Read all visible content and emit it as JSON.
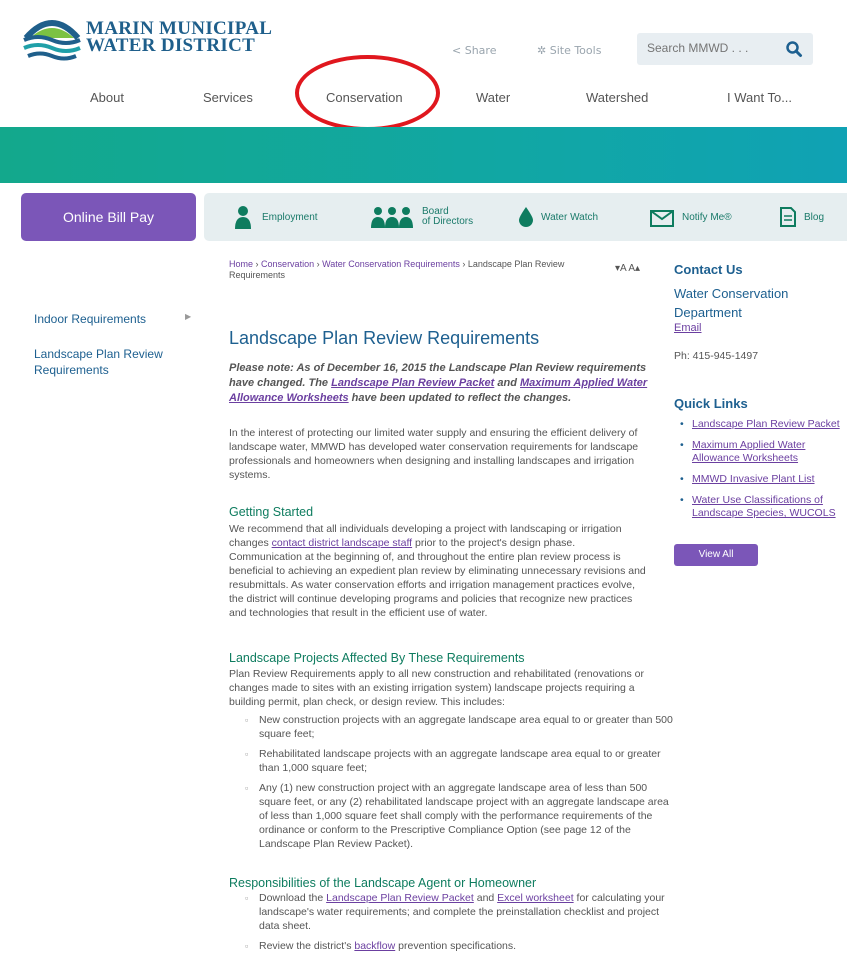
{
  "header": {
    "logo_line1": "MARIN MUNICIPAL",
    "logo_line2": "WATER DISTRICT",
    "share_label": "Share",
    "site_tools_label": "Site Tools",
    "search_placeholder": "Search MMWD . . ."
  },
  "nav": [
    "About",
    "Services",
    "Conservation",
    "Water",
    "Watershed",
    "I Want To..."
  ],
  "colors": {
    "brand_blue": "#1e6090",
    "purple": "#7b56b8",
    "teal": "#13a88c",
    "annotation_red": "#e0171e"
  },
  "bill_pay_label": "Online Bill Pay",
  "quick_bar": [
    {
      "label": "Employment",
      "icon": "person-icon"
    },
    {
      "label": "Board\nof Directors",
      "icon": "group-icon"
    },
    {
      "label": "Water Watch",
      "icon": "droplet-icon"
    },
    {
      "label": "Notify Me®",
      "icon": "envelope-icon"
    },
    {
      "label": "Blog",
      "icon": "document-icon"
    }
  ],
  "sidebar": [
    {
      "label": "Indoor Requirements"
    },
    {
      "label": "Landscape Plan Review Requirements"
    }
  ],
  "breadcrumb": {
    "home": "Home",
    "conservation": "Conservation",
    "water_conservation": "Water Conservation Requirements",
    "current": "Landscape Plan Review Requirements",
    "sep": "›"
  },
  "text_size_label": "▾A A▴",
  "page_title": "Landscape Plan Review Requirements",
  "note": {
    "p1": "Please note: As of December 16, 2015 the Landscape Plan Review requirements have changed. The ",
    "link1": "Landscape Plan Review Packet",
    "p2": " and ",
    "link2": "Maximum Applied Water Allowance Worksheets",
    "p3": " have been updated to reflect the changes."
  },
  "intro": "In the interest of protecting our limited water supply and ensuring the efficient delivery of landscape water, MMWD has developed water conservation requirements for landscape professionals and homeowners when designing and installing landscapes and irrigation systems.",
  "getting_started": {
    "heading": "Getting Started",
    "p1": "We recommend that all individuals developing a project with landscaping or irrigation changes ",
    "link": "contact district landscape staff",
    "p2": " prior to the project's design phase. Communication at the beginning of, and throughout the entire plan review process is beneficial to achieving an expedient plan review by eliminating unnecessary revisions and resubmittals. As water conservation efforts and irrigation management practices evolve, the district will continue developing programs and policies that recognize new practices and technologies that result in the efficient use of water."
  },
  "affected": {
    "heading": "Landscape Projects Affected By These Requirements",
    "p": "Plan Review Requirements apply to all new construction and rehabilitated (renovations or changes made to sites with an existing irrigation system) landscape projects requiring a building permit, plan check, or design review. This includes:",
    "items": [
      "New construction projects with an aggregate landscape area equal to or greater than 500 square feet;",
      "Rehabilitated landscape projects with an aggregate landscape area equal to or greater than 1,000 square feet;",
      "Any (1) new construction project with an aggregate landscape area of less than 500 square feet, or any (2) rehabilitated landscape project with an aggregate landscape area of less than 1,000 square feet shall comply with the performance requirements of the ordinance or conform to the Prescriptive Compliance Option (see page 12 of the Landscape Plan Review Packet)."
    ]
  },
  "responsibilities": {
    "heading": "Responsibilities of the Landscape Agent or Homeowner",
    "item1_a": "Download the ",
    "item1_link1": "Landscape Plan Review Packet",
    "item1_b": " and ",
    "item1_link2": "Excel worksheet",
    "item1_c": " for calculating your landscape's water requirements; and complete the preinstallation checklist and project data sheet.",
    "item2_a": "Review the district's ",
    "item2_link": "backflow",
    "item2_b": " prevention specifications."
  },
  "contact": {
    "heading": "Contact Us",
    "dept": "Water Conservation Department",
    "email": "Email",
    "phone": "Ph: 415-945-1497"
  },
  "quick_links": {
    "heading": "Quick Links",
    "items": [
      "Landscape Plan Review Packet",
      "Maximum Applied Water Allowance Worksheets",
      "MMWD Invasive Plant List",
      "Water Use Classifications of Landscape Species, WUCOLS"
    ],
    "view_all": "View All"
  }
}
